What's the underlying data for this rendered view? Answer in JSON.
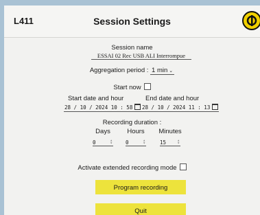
{
  "header": {
    "device_id": "L411",
    "title": "Session Settings"
  },
  "session": {
    "name_label": "Session name",
    "name_value": "ESSAI 02 Rec USB ALI Interrompue"
  },
  "aggregation": {
    "label": "Aggregation period :",
    "value": "1 min"
  },
  "start_now": {
    "label": "Start now",
    "checked": false
  },
  "start_date": {
    "label": "Start date and hour",
    "value": "28 / 10 / 2024  10 : 58"
  },
  "end_date": {
    "label": "End date and hour",
    "value": "28 / 10 / 2024  11 : 13"
  },
  "duration": {
    "label": "Recording duration :",
    "days_label": "Days",
    "days_value": "0",
    "hours_label": "Hours",
    "hours_value": "0",
    "minutes_label": "Minutes",
    "minutes_value": "15"
  },
  "extended_mode": {
    "label": "Activate extended recording mode",
    "checked": false
  },
  "buttons": {
    "program": "Program recording",
    "quit": "Quit"
  },
  "colors": {
    "button": "#ede33c",
    "logo": "#f0d000",
    "background": "#a9c2d4"
  }
}
